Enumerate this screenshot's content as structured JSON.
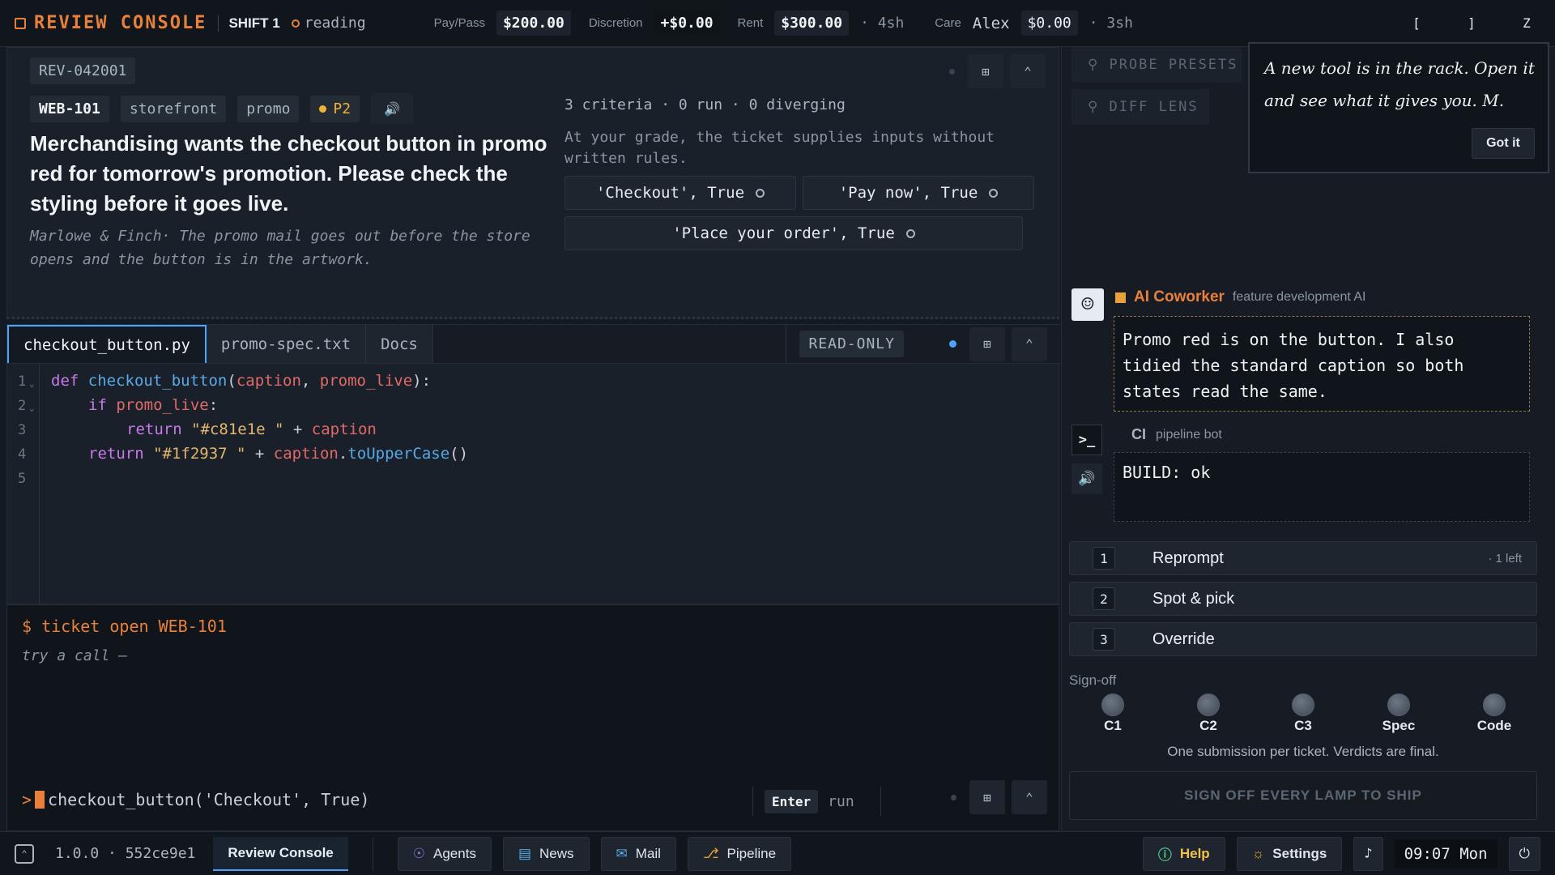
{
  "topbar": {
    "title": "REVIEW CONSOLE",
    "shift": "SHIFT 1",
    "status": "reading",
    "paypass_label": "Pay/Pass",
    "paypass_value": "$200.00",
    "discretion_label": "Discretion",
    "discretion_value": "+$0.00",
    "rent_label": "Rent",
    "rent_value": "$300.00",
    "rent_due": "· 4sh",
    "care_label": "Care",
    "care_name": "Alex",
    "care_value": "$0.00",
    "care_due": "· 3sh",
    "keys": [
      "[",
      "]",
      "Z"
    ]
  },
  "ticket": {
    "id": "REV-042001",
    "code": "WEB-101",
    "tags": [
      "storefront",
      "promo"
    ],
    "priority": "P2",
    "title": "Merchandising wants the checkout button in promo red for tomorrow's promotion. Please check the styling before it goes live.",
    "note": "Marlowe & Finch· The promo mail goes out before the store opens and the button is in the artwork.",
    "criteria_summary": "3 criteria · 0 run · 0 diverging",
    "criteria_note": "At your grade, the ticket supplies inputs without written rules.",
    "criteria": [
      "'Checkout', True",
      "'Pay now', True",
      "'Place your order', True"
    ]
  },
  "editor": {
    "tabs": [
      "checkout_button.py",
      "promo-spec.txt",
      "Docs"
    ],
    "mode": "READ-ONLY",
    "lines": [
      "1",
      "2",
      "3",
      "4",
      "5"
    ],
    "code": {
      "l1_def": "def ",
      "l1_fn": "checkout_button",
      "l1_open": "(",
      "l1_p1": "caption",
      "l1_comma": ", ",
      "l1_p2": "promo_live",
      "l1_close": "):",
      "l2_if": "if ",
      "l2_var": "promo_live",
      "l2_colon": ":",
      "l3_ret": "return ",
      "l3_str": "\"#c81e1e \"",
      "l3_plus": " + ",
      "l3_var": "caption",
      "l4_ret": "return ",
      "l4_str": "\"#1f2937 \"",
      "l4_plus": " + ",
      "l4_var": "caption",
      "l4_dot": ".",
      "l4_meth": "toUpperCase",
      "l4_paren": "()"
    }
  },
  "terminal": {
    "command": "$ ticket open WEB-101",
    "hint": "try a call —",
    "prompt": ">",
    "input": "checkout_button('Checkout', True)",
    "enter_key": "Enter",
    "enter_label": "run"
  },
  "sidebar": {
    "probe_presets": "PROBE PRESETS",
    "diff_lens": "DIFF LENS",
    "tooltip_text": "A new tool is in the rack. Open it and see what it gives you. M.",
    "tooltip_button": "Got it"
  },
  "chat": {
    "ai_name": "AI Coworker",
    "ai_role": "feature development AI",
    "ai_message": "Promo red is on the button. I also tidied the standard caption so both states read the same.",
    "ci_name": "CI",
    "ci_role": "pipeline bot",
    "ci_message": "BUILD: ok"
  },
  "actions": [
    {
      "num": "1",
      "label": "Reprompt",
      "meta": "· 1 left"
    },
    {
      "num": "2",
      "label": "Spot & pick",
      "meta": ""
    },
    {
      "num": "3",
      "label": "Override",
      "meta": ""
    }
  ],
  "signoff": {
    "label": "Sign-off",
    "lamps": [
      "C1",
      "C2",
      "C3",
      "Spec",
      "Code"
    ],
    "note": "One submission per ticket. Verdicts are final.",
    "button": "SIGN OFF EVERY LAMP TO SHIP"
  },
  "taskbar": {
    "version": "1.0.0 · 552ce9e1",
    "apps": [
      "Review Console",
      "Agents",
      "News",
      "Mail",
      "Pipeline"
    ],
    "help": "Help",
    "settings": "Settings",
    "clock": "09:07 Mon"
  },
  "colors": {
    "accent": "#e8803a",
    "promo_red": "#c81e1e",
    "status_dot": "#f2b233",
    "live_dot": "#4da3ff"
  }
}
